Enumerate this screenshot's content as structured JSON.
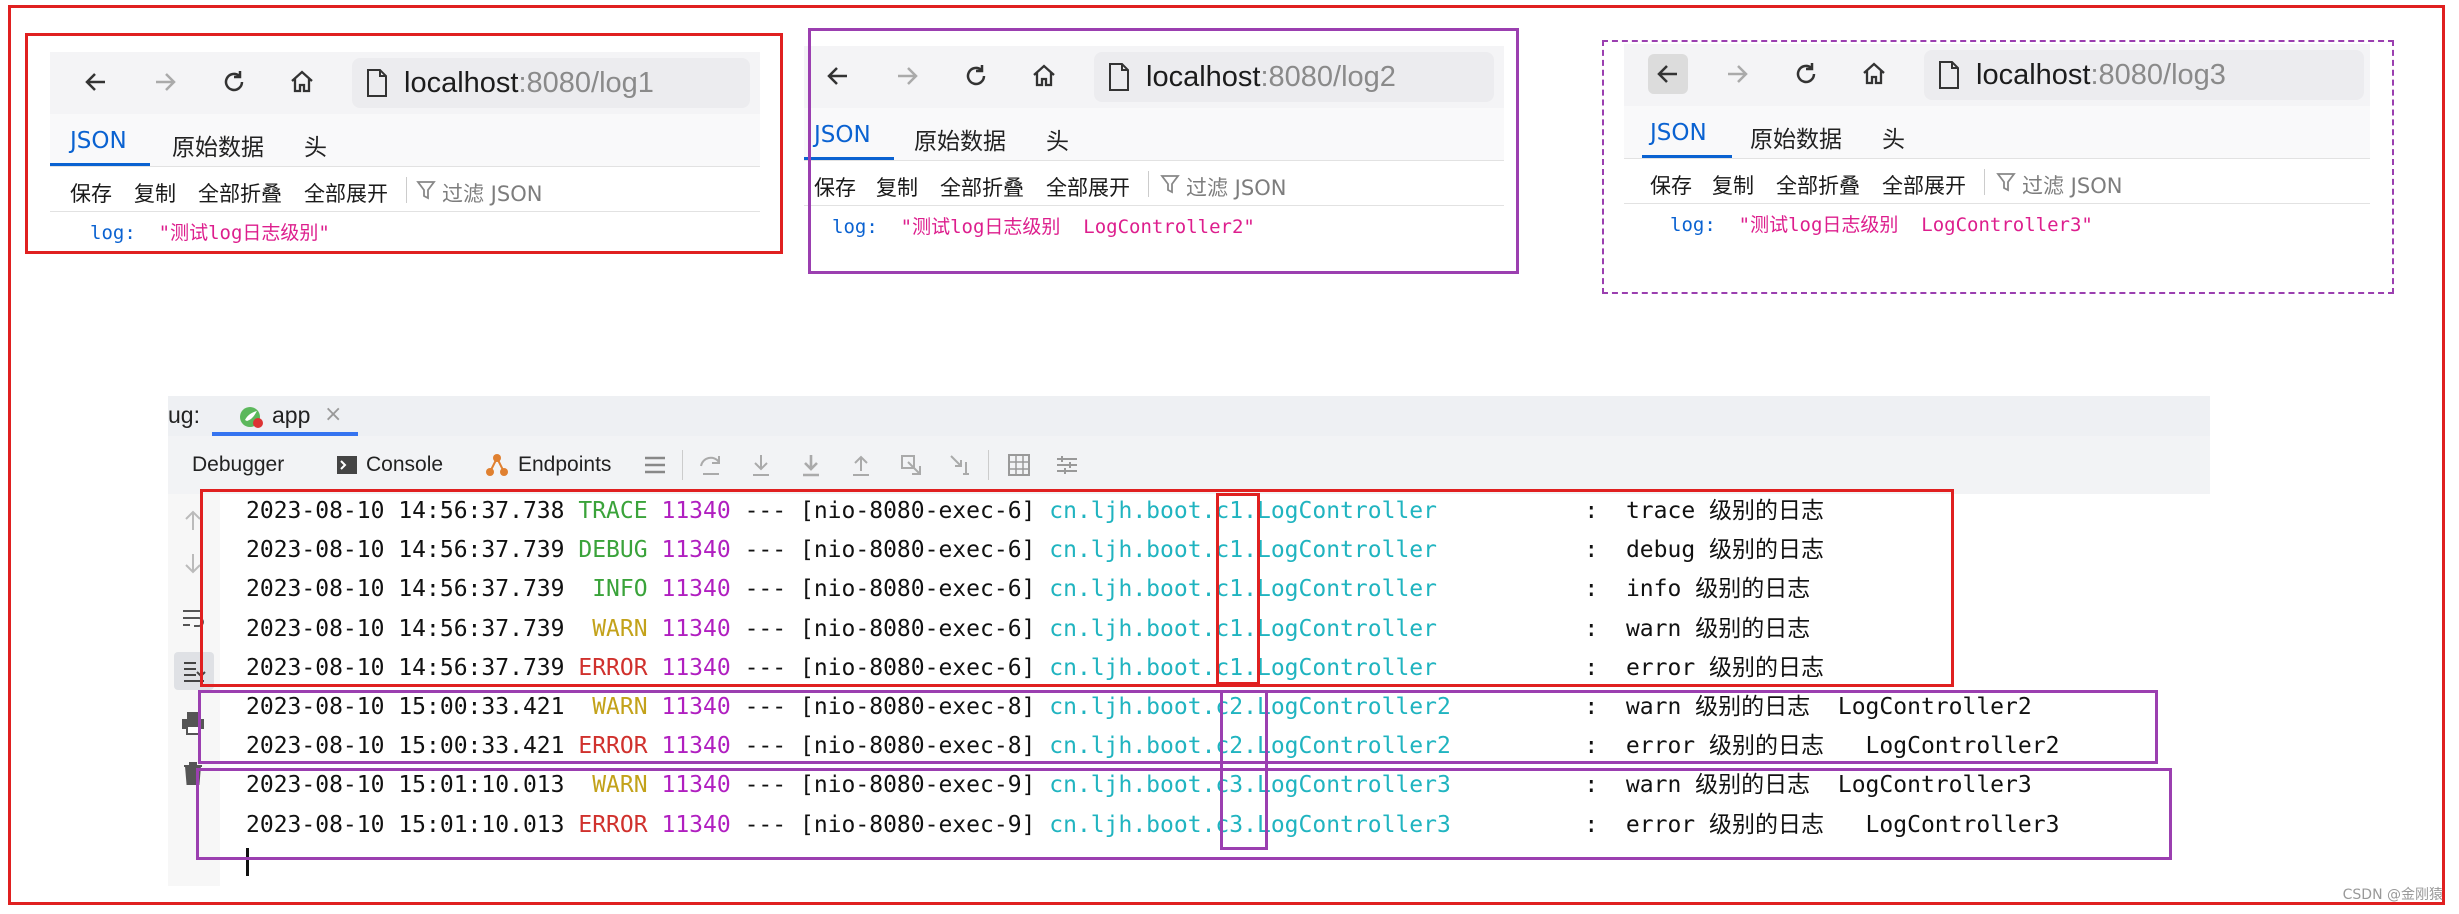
{
  "browsers": [
    {
      "url_host": "localhost",
      "url_rest": ":8080/log1",
      "tabs": [
        "JSON",
        "原始数据",
        "头"
      ],
      "tools": [
        "保存",
        "复制",
        "全部折叠",
        "全部展开",
        "过滤 JSON"
      ],
      "json_key": "log:",
      "json_value": "\"测试log日志级别\""
    },
    {
      "url_host": "localhost",
      "url_rest": ":8080/log2",
      "tabs": [
        "JSON",
        "原始数据",
        "头"
      ],
      "tools": [
        "保存",
        "复制",
        "全部折叠",
        "全部展开",
        "过滤 JSON"
      ],
      "json_key": "log:",
      "json_value": "\"测试log日志级别  LogController2\""
    },
    {
      "url_host": "localhost",
      "url_rest": ":8080/log3",
      "tabs": [
        "JSON",
        "原始数据",
        "头"
      ],
      "tools": [
        "保存",
        "复制",
        "全部折叠",
        "全部展开",
        "过滤 JSON"
      ],
      "json_key": "log:",
      "json_value": "\"测试log日志级别  LogController3\""
    }
  ],
  "ide": {
    "debug_label": "ug:",
    "app_tab": "app",
    "toolbar": {
      "debugger": "Debugger",
      "console": "Console",
      "endpoints": "Endpoints"
    },
    "lines": [
      {
        "ts": "2023-08-10 14:56:37.738",
        "level": "TRACE",
        "lvl": "trace",
        "pid": "11340",
        "sep": "---",
        "thread": "[nio-8080-exec-6]",
        "pkg": "cn.ljh.boot.",
        "sub": "c1",
        "cls": ".LogController",
        "colon": ":",
        "msg": "trace 级别的日志",
        "suffix": ""
      },
      {
        "ts": "2023-08-10 14:56:37.739",
        "level": "DEBUG",
        "lvl": "debug",
        "pid": "11340",
        "sep": "---",
        "thread": "[nio-8080-exec-6]",
        "pkg": "cn.ljh.boot.",
        "sub": "c1",
        "cls": ".LogController",
        "colon": ":",
        "msg": "debug 级别的日志",
        "suffix": ""
      },
      {
        "ts": "2023-08-10 14:56:37.739",
        "level": " INFO",
        "lvl": "info",
        "pid": "11340",
        "sep": "---",
        "thread": "[nio-8080-exec-6]",
        "pkg": "cn.ljh.boot.",
        "sub": "c1",
        "cls": ".LogController",
        "colon": ":",
        "msg": "info 级别的日志",
        "suffix": ""
      },
      {
        "ts": "2023-08-10 14:56:37.739",
        "level": " WARN",
        "lvl": "warn",
        "pid": "11340",
        "sep": "---",
        "thread": "[nio-8080-exec-6]",
        "pkg": "cn.ljh.boot.",
        "sub": "c1",
        "cls": ".LogController",
        "colon": ":",
        "msg": "warn 级别的日志",
        "suffix": ""
      },
      {
        "ts": "2023-08-10 14:56:37.739",
        "level": "ERROR",
        "lvl": "error",
        "pid": "11340",
        "sep": "---",
        "thread": "[nio-8080-exec-6]",
        "pkg": "cn.ljh.boot.",
        "sub": "c1",
        "cls": ".LogController",
        "colon": ":",
        "msg": "error 级别的日志",
        "suffix": ""
      },
      {
        "ts": "2023-08-10 15:00:33.421",
        "level": " WARN",
        "lvl": "warn",
        "pid": "11340",
        "sep": "---",
        "thread": "[nio-8080-exec-8]",
        "pkg": "cn.ljh.boot.",
        "sub": "c2",
        "cls": ".LogController2",
        "colon": ":",
        "msg": "warn 级别的日志",
        "suffix": "LogController2"
      },
      {
        "ts": "2023-08-10 15:00:33.421",
        "level": "ERROR",
        "lvl": "error",
        "pid": "11340",
        "sep": "---",
        "thread": "[nio-8080-exec-8]",
        "pkg": "cn.ljh.boot.",
        "sub": "c2",
        "cls": ".LogController2",
        "colon": ":",
        "msg": "error 级别的日志",
        "suffix": " LogController2"
      },
      {
        "ts": "2023-08-10 15:01:10.013",
        "level": " WARN",
        "lvl": "warn",
        "pid": "11340",
        "sep": "---",
        "thread": "[nio-8080-exec-9]",
        "pkg": "cn.ljh.boot.",
        "sub": "c3",
        "cls": ".LogController3",
        "colon": ":",
        "msg": "warn 级别的日志",
        "suffix": "LogController3"
      },
      {
        "ts": "2023-08-10 15:01:10.013",
        "level": "ERROR",
        "lvl": "error",
        "pid": "11340",
        "sep": "---",
        "thread": "[nio-8080-exec-9]",
        "pkg": "cn.ljh.boot.",
        "sub": "c3",
        "cls": ".LogController3",
        "colon": ":",
        "msg": "error 级别的日志",
        "suffix": " LogController3"
      }
    ]
  },
  "watermark": "CSDN @金刚猿",
  "colors": {
    "highlight_red": "#e02020",
    "highlight_purple": "#9b3fb0",
    "json_key": "#0a62d1",
    "json_value": "#dd1e8d"
  }
}
